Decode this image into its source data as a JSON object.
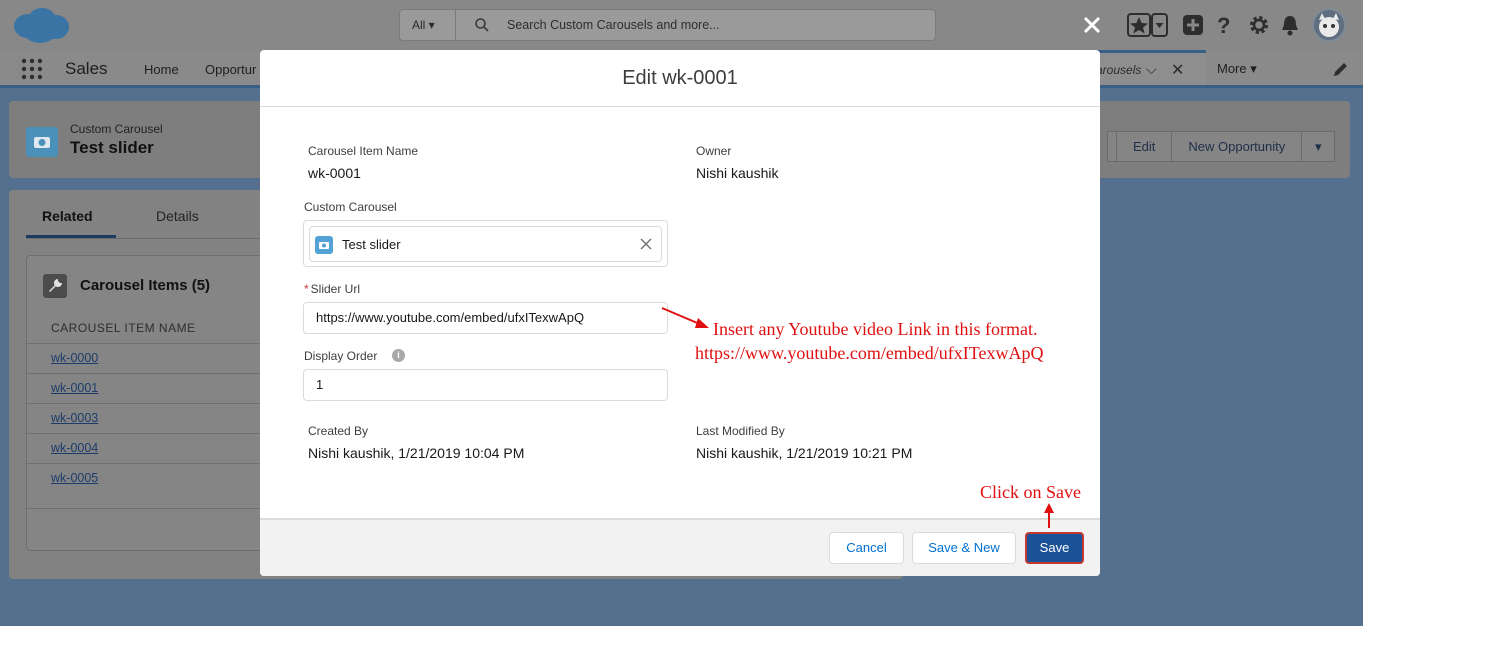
{
  "topbar": {
    "search_scope": "All",
    "search_placeholder": "Search Custom Carousels and more..."
  },
  "nav": {
    "app_name": "Sales",
    "items": [
      "Home",
      "Opportur"
    ],
    "active_tab": "arousels",
    "more_label": "More"
  },
  "record": {
    "type": "Custom Carousel",
    "name": "Test slider",
    "actions": [
      "Edit",
      "New Opportunity"
    ]
  },
  "related": {
    "tabs": [
      "Related",
      "Details"
    ],
    "list_title": "Carousel Items (5)",
    "column_header": "CAROUSEL ITEM NAME",
    "rows": [
      "wk-0000",
      "wk-0001",
      "wk-0003",
      "wk-0004",
      "wk-0005"
    ]
  },
  "modal": {
    "title": "Edit wk-0001",
    "item_name_label": "Carousel Item Name",
    "item_name_value": "wk-0001",
    "owner_label": "Owner",
    "owner_value": "Nishi kaushik",
    "custom_carousel_label": "Custom Carousel",
    "custom_carousel_value": "Test slider",
    "slider_url_required": "*",
    "slider_url_label": "Slider Url",
    "slider_url_value": "https://www.youtube.com/embed/ufxITexwApQ",
    "display_order_label": "Display Order",
    "display_order_value": "1",
    "created_by_label": "Created By",
    "created_by_value": "Nishi kaushik, 1/21/2019 10:04 PM",
    "last_modified_label": "Last Modified By",
    "last_modified_value": "Nishi kaushik, 1/21/2019 10:21 PM",
    "cancel_label": "Cancel",
    "save_new_label": "Save & New",
    "save_label": "Save"
  },
  "annotations": {
    "url_hint_line1": "Insert any Youtube video Link in this format.",
    "url_hint_line2": "https://www.youtube.com/embed/ufxITexwApQ",
    "save_hint": "Click on Save"
  },
  "colors": {
    "annotation": "#e01010",
    "primary_button": "#1b5297",
    "link": "#0070d2"
  },
  "icons": [
    "salesforce-cloud-icon",
    "search-icon",
    "close-icon",
    "favorites-icon",
    "add-icon",
    "help-icon",
    "setup-gear-icon",
    "notifications-bell-icon",
    "app-launcher-icon",
    "edit-pencil-icon",
    "camera-icon",
    "wrench-icon",
    "info-icon"
  ]
}
